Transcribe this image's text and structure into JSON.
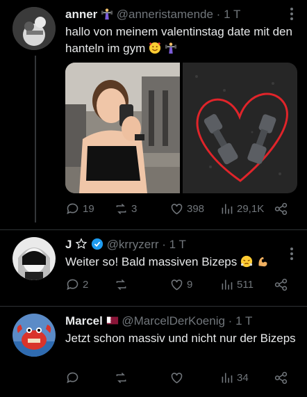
{
  "tweets": [
    {
      "name": "anner",
      "name_emoji": "weightlifter",
      "handle": "@anneristamende",
      "separator": "·",
      "time": "1 T",
      "text": "hallo von meinem valentinstag date mit den hanteln im gym",
      "text_emojis": [
        "smiling-face-with-hearts",
        "weightlifter"
      ],
      "media": [
        "gym-mirror-selfie-photo",
        "dumbbells-with-red-heart-photo"
      ],
      "stats": {
        "replies": "19",
        "retweets": "3",
        "likes": "398",
        "views": "29,1K"
      }
    },
    {
      "name": "J",
      "name_emoji": "star-outline",
      "verified": true,
      "handle": "@krryzerr",
      "separator": "·",
      "time": "1 T",
      "text": "Weiter so! Bald massiven Bizeps",
      "text_emojis": [
        "face-with-steam",
        "flexed-biceps"
      ],
      "stats": {
        "replies": "2",
        "retweets": "",
        "likes": "9",
        "views": "511"
      }
    },
    {
      "name": "Marcel",
      "name_emoji": "flag-qatar",
      "handle": "@MarcelDerKoenig",
      "separator": "·",
      "time": "1 T",
      "text": "Jetzt schon massiv und nicht nur der Bizeps",
      "stats": {
        "replies": "",
        "retweets": "",
        "likes": "",
        "views": "34"
      }
    }
  ],
  "colors": {
    "background": "#000000",
    "text": "#e7e9ea",
    "muted": "#71767b",
    "verified": "#1d9bf0",
    "heart_drawing": "#e0242a"
  }
}
